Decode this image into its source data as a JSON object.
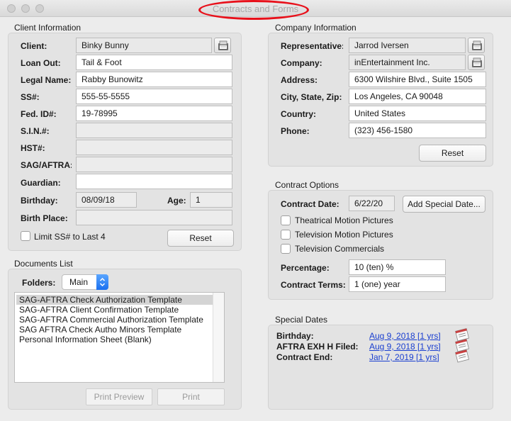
{
  "window": {
    "title": "Contracts and Forms"
  },
  "client": {
    "group_label": "Client Information",
    "client_label": "Client:",
    "client_value": "Binky Bunny",
    "loan_out_label": "Loan Out:",
    "loan_out_value": "Tail & Foot",
    "legal_name_label": "Legal Name:",
    "legal_name_value": "Rabby Bunowitz",
    "ss_label": "SS#:",
    "ss_value": "555-55-5555",
    "fed_id_label": "Fed. ID#:",
    "fed_id_value": "19-78995",
    "sin_label": "S.I.N.#:",
    "sin_value": "",
    "hst_label": "HST#:",
    "hst_value": "",
    "sag_label": "SAG/AFTRA:",
    "sag_value": "",
    "guardian_label": "Guardian:",
    "guardian_value": "",
    "birthday_label": "Birthday:",
    "birthday_value": "08/09/18",
    "age_label": "Age:",
    "age_value": "1",
    "birth_place_label": "Birth Place:",
    "birth_place_value": "",
    "limit_ss_label": "Limit SS# to Last 4",
    "reset_label": "Reset"
  },
  "company": {
    "group_label": "Company Information",
    "representative_label": "Representative:",
    "representative_value": "Jarrod Iversen",
    "company_label": "Company:",
    "company_value": "inEntertainment Inc.",
    "address_label": "Address:",
    "address_value": "6300 Wilshire Blvd., Suite 1505",
    "city_label": "City, State, Zip:",
    "city_value": "Los Angeles, CA 90048",
    "country_label": "Country:",
    "country_value": "United States",
    "phone_label": "Phone:",
    "phone_value": "(323) 456-1580",
    "reset_label": "Reset"
  },
  "documents": {
    "group_label": "Documents List",
    "folders_label": "Folders:",
    "folder_selected": "Main",
    "items": [
      "SAG-AFTRA Check Authorization Template",
      "SAG-AFTRA Client Confirmation Template",
      "SAG-AFTRA Commercial Authorization Template",
      "SAG AFTRA Check Autho Minors Template",
      "Personal Information Sheet (Blank)"
    ],
    "selected_index": 0,
    "print_preview_label": "Print Preview",
    "print_label": "Print"
  },
  "contract_options": {
    "group_label": "Contract Options",
    "contract_date_label": "Contract Date:",
    "contract_date_value": "6/22/20",
    "add_special_date_label": "Add Special Date...",
    "options": [
      {
        "label": "Theatrical Motion Pictures",
        "checked": false
      },
      {
        "label": "Television Motion Pictures",
        "checked": false
      },
      {
        "label": "Television Commercials",
        "checked": false
      }
    ],
    "percentage_label": "Percentage:",
    "percentage_value": "10 (ten) %",
    "terms_label": "Contract Terms:",
    "terms_value": "1 (one) year"
  },
  "special_dates": {
    "group_label": "Special Dates",
    "rows": [
      {
        "label": "Birthday:",
        "value": "Aug 9, 2018 [1 yrs]"
      },
      {
        "label": "AFTRA EXH H Filed:",
        "value": "Aug 9, 2018 [1 yrs]"
      },
      {
        "label": "Contract End:",
        "value": "Jan 7, 2019 [1 yrs]"
      }
    ]
  },
  "colors": {
    "link": "#1a3fd0",
    "highlight_circle": "#e8101a",
    "select_accent": "#1a6fef"
  },
  "icons": [
    "address-card-icon",
    "calendar-dates-icon",
    "chevron-updown-icon"
  ]
}
